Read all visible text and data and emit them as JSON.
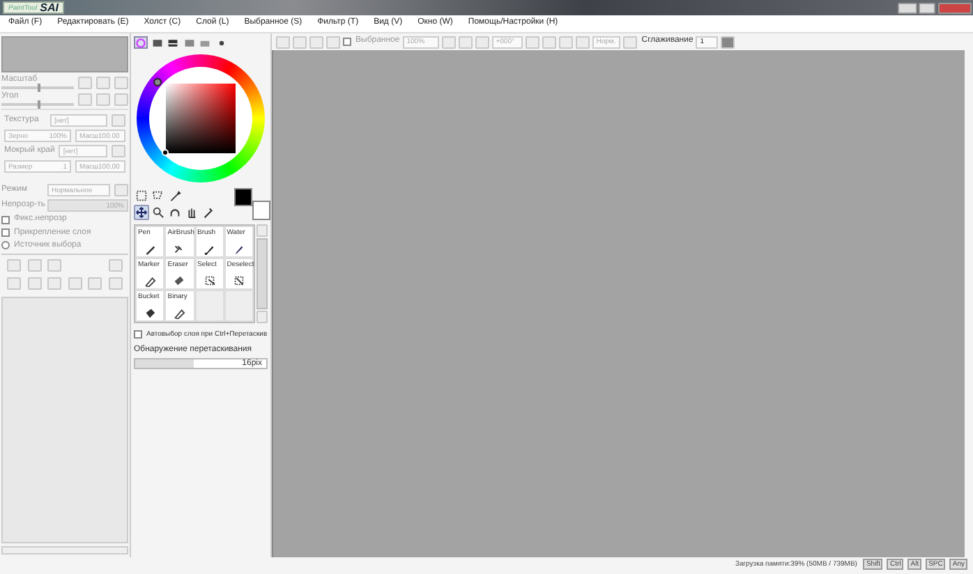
{
  "title_bar": {
    "logo_small": "PaintTool",
    "logo_big": "SAI"
  },
  "menu": [
    "Файл (F)",
    "Редактировать (E)",
    "Холст (C)",
    "Слой (L)",
    "Выбранное (S)",
    "Фильтр (T)",
    "Вид (V)",
    "Окно (W)",
    "Помощь/Настройки (H)"
  ],
  "toolbar": {
    "selection": {
      "label": "Выбранное",
      "checked": false
    },
    "zoom": "100%",
    "angle": "+000°",
    "blend": "Норм.",
    "smoothing_label": "Сглаживание",
    "smoothing": "1"
  },
  "navigator": {
    "sliders": [
      {
        "label": "Масштаб",
        "level": 0.5
      },
      {
        "label": "Угол",
        "level": 0.5
      }
    ]
  },
  "brush_settings": [
    {
      "kind": "dropdown",
      "label": "Текстура",
      "value": "[нет]"
    },
    {
      "kind": "pair",
      "label": "Зерно",
      "value": "100%",
      "value2": "Масш100.00"
    },
    {
      "kind": "dropdown",
      "label": "Мокрый край",
      "value": "[нет]"
    },
    {
      "kind": "pair",
      "label": "Размер",
      "value": "1",
      "value2": "Масш100.00"
    }
  ],
  "layer": {
    "mode_label": "Режим",
    "mode": "Нормальное",
    "opacity_label": "Непрозр-ть",
    "opacity": {
      "value": "100%",
      "level": 1
    },
    "options": [
      {
        "kind": "check",
        "label": "Фикс.непрозр",
        "checked": false
      },
      {
        "kind": "check",
        "label": "Прикрепление слоя",
        "checked": false
      },
      {
        "kind": "radio",
        "label": "Источник выбора",
        "checked": false
      }
    ]
  },
  "color_tabs": [
    {
      "selected": true
    },
    {
      "selected": false
    },
    {
      "selected": false
    },
    {
      "selected": false
    },
    {
      "selected": false
    },
    {
      "selected": false
    }
  ],
  "swatches": [
    {
      "color": "#000000"
    },
    {
      "color": "#ffffff"
    }
  ],
  "tools": [
    {
      "name": "Pen"
    },
    {
      "name": "AirBrush"
    },
    {
      "name": "Brush"
    },
    {
      "name": "Water"
    },
    {
      "name": "Marker"
    },
    {
      "name": "Eraser"
    },
    {
      "name": "Select"
    },
    {
      "name": "Deselect"
    },
    {
      "name": "Bucket"
    },
    {
      "name": "Binary"
    }
  ],
  "auto_select": {
    "label": "Автовыбор слоя при Ctrl+Перетаскив",
    "checked": false
  },
  "drag_detect": {
    "label": "Обнаружение перетаскивания",
    "value": "16pix",
    "level": 0.45
  },
  "status_bar": {
    "memory": "Загрузка памяти:39% (50MB / 739MB)",
    "keys": [
      "Shift",
      "Ctrl",
      "Alt",
      "SPC",
      "Any"
    ]
  }
}
